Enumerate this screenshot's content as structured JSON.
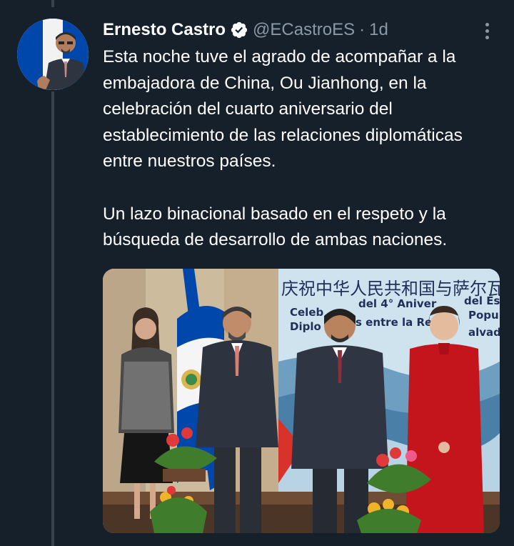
{
  "tweet": {
    "author_name": "Ernesto Castro",
    "verified": true,
    "handle": "@ECastroES",
    "separator": "·",
    "timestamp": "1d",
    "text_paragraph_1": "Esta noche tuve el agrado de acompañar a la embajadora de China, Ou Jianhong, en la celebración del cuarto aniversario del establecimiento de las relaciones diplomáticas entre nuestros países.",
    "text_paragraph_2": "Un lazo binacional basado en el respeto y la búsqueda de desarrollo de ambas naciones."
  },
  "media": {
    "banner_line_1": "庆祝中华人民共和国与萨尔瓦",
    "banner_line_2a": "Celeb",
    "banner_line_2b": "del 4° Aniver",
    "banner_line_2c": "del Est",
    "banner_line_3a": "Diplo",
    "banner_line_3b": "s entre la Re",
    "banner_line_3c": "Popu",
    "banner_line_4": "alvado"
  },
  "icons": {
    "verified": "verified-badge-icon",
    "more": "more-options-icon"
  },
  "colors": {
    "background": "#15202b",
    "primary_text": "#ffffff",
    "secondary_text": "#8b98a5",
    "thread_line": "#38444d"
  }
}
